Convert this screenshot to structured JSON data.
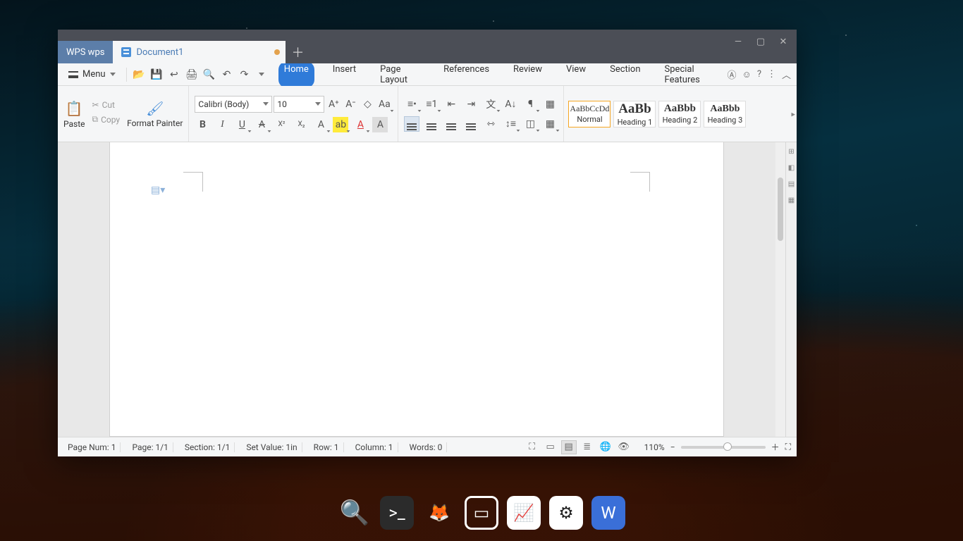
{
  "tabs": {
    "app": "WPS wps",
    "doc": "Document1"
  },
  "menu_label": "Menu",
  "ribbon_tabs": [
    "Home",
    "Insert",
    "Page Layout",
    "References",
    "Review",
    "View",
    "Section",
    "Special Features"
  ],
  "clipboard": {
    "paste": "Paste",
    "cut": "Cut",
    "copy": "Copy",
    "painter": "Format Painter"
  },
  "font": {
    "name": "Calibri (Body)",
    "size": "10"
  },
  "styles": {
    "preview": "AaBbCcDd",
    "h1_prev": "AaBb",
    "h2_prev": "AaBbb",
    "h3_prev": "AaBbb",
    "normal": "Normal",
    "h1": "Heading 1",
    "h2": "Heading 2",
    "h3": "Heading 3"
  },
  "status": {
    "page_num": "Page Num: 1",
    "page": "Page: 1/1",
    "section": "Section: 1/1",
    "setval": "Set Value: 1in",
    "row": "Row: 1",
    "col": "Column: 1",
    "words": "Words: 0",
    "zoom": "110%"
  }
}
